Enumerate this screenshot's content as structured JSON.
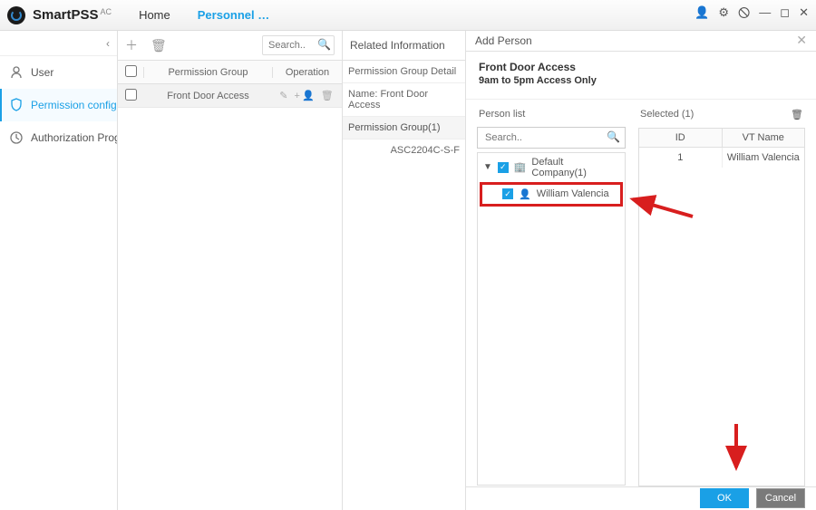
{
  "app": {
    "name": "SmartPSS",
    "suffix": "AC"
  },
  "tabs": {
    "home": "Home",
    "personnel": "Personnel …"
  },
  "sidebar": {
    "user": "User",
    "perm": "Permission config…",
    "auth": "Authorization Prog…"
  },
  "grid": {
    "search_ph": "Search..",
    "col_group": "Permission Group",
    "col_op": "Operation",
    "row1": "Front Door Access"
  },
  "info": {
    "title": "Related Information",
    "detail": "Permission Group Detail",
    "name": "Name: Front Door Access",
    "group": "Permission Group(1)",
    "device": "ASC2204C-S-F"
  },
  "panel": {
    "title": "Add Person",
    "h1": "Front Door Access",
    "h2": "9am to 5pm Access Only",
    "person_list": "Person list",
    "selected": "Selected (1)",
    "search_ph": "Search..",
    "tree_root": "Default Company(1)",
    "tree_person": "William Valencia",
    "col_id": "ID",
    "col_name": "VT Name",
    "row_id": "1",
    "row_name": "William Valencia",
    "ok": "OK",
    "cancel": "Cancel"
  }
}
